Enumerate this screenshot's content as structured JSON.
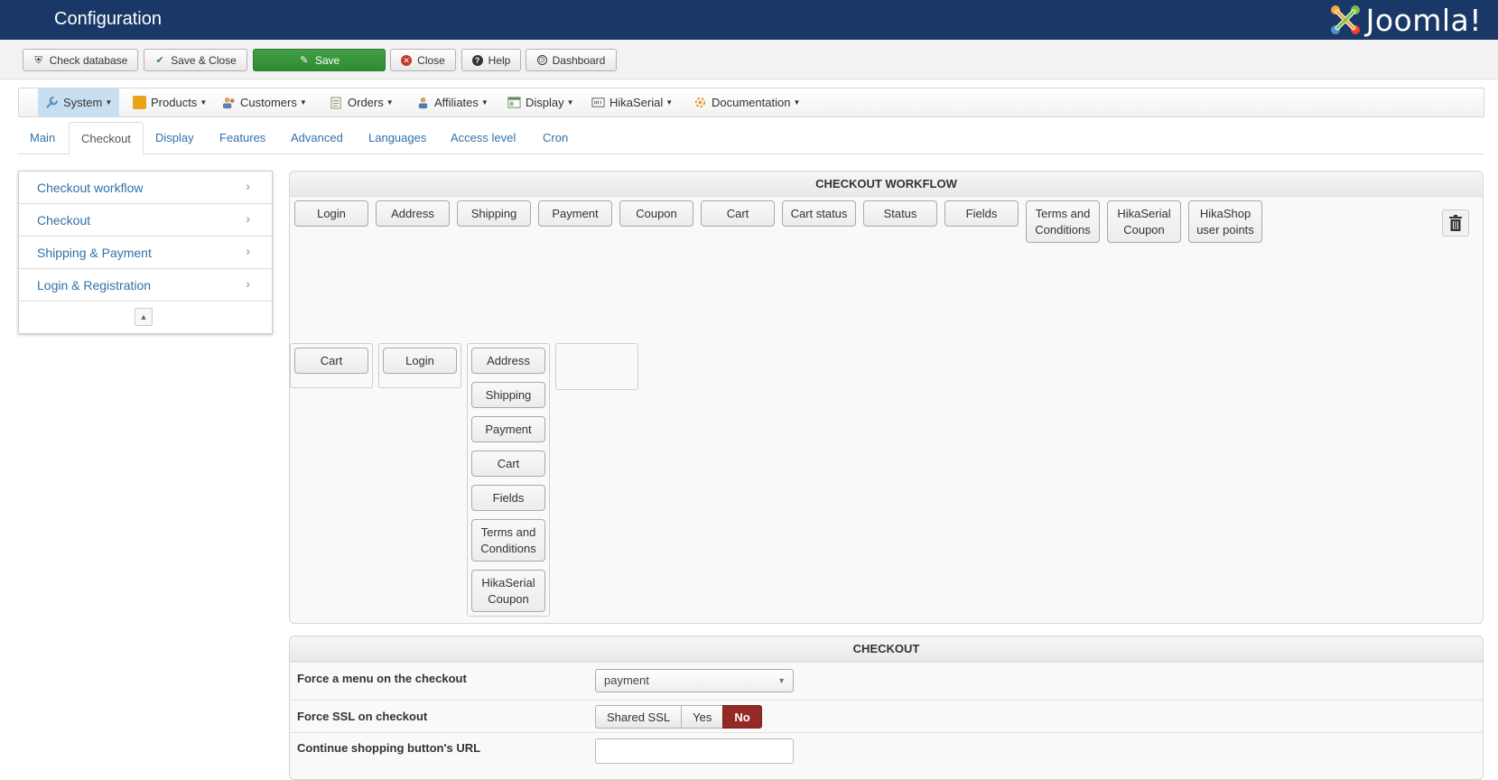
{
  "header": {
    "title": "Configuration",
    "logo_text": "Joomla!"
  },
  "toolbar": {
    "check_database": "Check database",
    "save_close": "Save & Close",
    "save": "Save",
    "close": "Close",
    "help": "Help",
    "dashboard": "Dashboard"
  },
  "menu": {
    "items": [
      {
        "label": "System",
        "icon": "wrench-icon",
        "color": "#5b8fb9"
      },
      {
        "label": "Products",
        "icon": "box-icon",
        "color": "#e8a317"
      },
      {
        "label": "Customers",
        "icon": "users-icon",
        "color": "#7a6a9c"
      },
      {
        "label": "Orders",
        "icon": "orders-icon",
        "color": "#8a9a5b"
      },
      {
        "label": "Affiliates",
        "icon": "affiliates-icon",
        "color": "#4a7fb0"
      },
      {
        "label": "Display",
        "icon": "display-icon",
        "color": "#6a8a6a"
      },
      {
        "label": "HikaSerial",
        "icon": "serial-icon",
        "color": "#555555"
      },
      {
        "label": "Documentation",
        "icon": "documentation-icon",
        "color": "#e89a2a"
      }
    ]
  },
  "tabs": [
    "Main",
    "Checkout",
    "Display",
    "Features",
    "Advanced",
    "Languages",
    "Access level",
    "Cron"
  ],
  "sidebar": {
    "items": [
      "Checkout workflow",
      "Checkout",
      "Shipping & Payment",
      "Login & Registration"
    ]
  },
  "workflow": {
    "title": "CHECKOUT WORKFLOW",
    "palette": [
      "Login",
      "Address",
      "Shipping",
      "Payment",
      "Coupon",
      "Cart",
      "Cart status",
      "Status",
      "Fields",
      "Terms and Conditions",
      "HikaSerial Coupon",
      "HikaShop user points"
    ],
    "steps": [
      [
        "Cart"
      ],
      [
        "Login"
      ],
      [
        "Address",
        "Shipping",
        "Payment",
        "Cart",
        "Fields",
        "Terms and Conditions",
        "HikaSerial Coupon"
      ],
      []
    ]
  },
  "checkout": {
    "title": "CHECKOUT",
    "force_menu_label": "Force a menu on the checkout",
    "force_menu_value": "payment",
    "force_ssl_label": "Force SSL on checkout",
    "force_ssl_options": [
      "Shared SSL",
      "Yes",
      "No"
    ],
    "force_ssl_selected": "No",
    "continue_url_label": "Continue shopping button's URL",
    "continue_url_value": ""
  }
}
